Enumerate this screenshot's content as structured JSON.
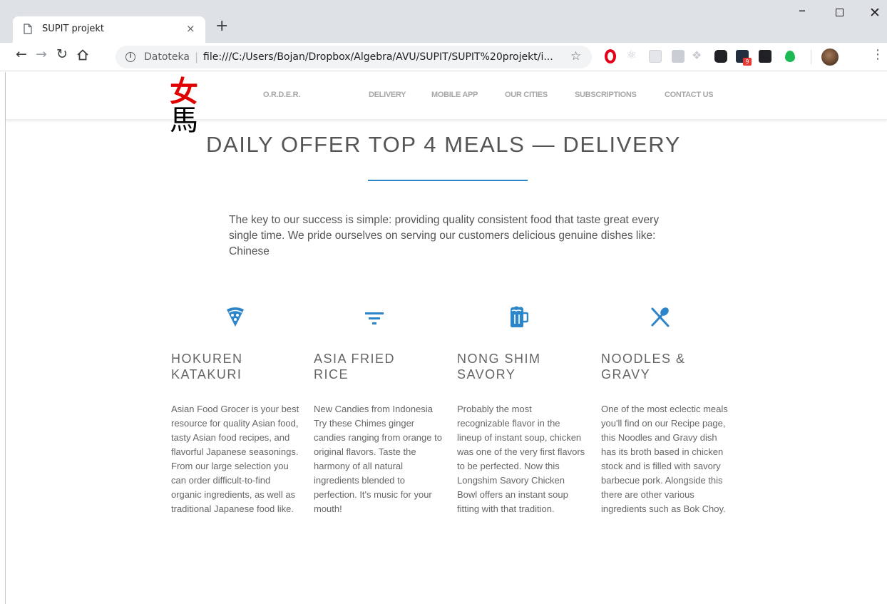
{
  "browser": {
    "tab_title": "SUPIT projekt",
    "tab_close": "×",
    "new_tab": "+",
    "url_scheme": "Datoteka",
    "url_separator": "|",
    "url": "file:///C:/Users/Bojan/Dropbox/Algebra/AVU/SUPIT/SUPIT%20projekt/i...",
    "ext_badge": "9",
    "window_min": "–",
    "window_close": "✕"
  },
  "header": {
    "logo_char_1": "女",
    "logo_char_2": "馬",
    "nav": [
      {
        "label": "O.R.D.E.R."
      },
      {
        "label": "DELIVERY"
      },
      {
        "label": "MOBILE APP"
      },
      {
        "label": "OUR CITIES"
      },
      {
        "label": "SUBSCRIPTIONS"
      },
      {
        "label": "CONTACT US"
      }
    ]
  },
  "main": {
    "title": "DAILY OFFER TOP 4 MEALS — DELIVERY",
    "intro": "The key to our success is simple: providing quality consistent food that taste great every single time. We pride ourselves on serving our customers delicious genuine dishes like: Chinese",
    "accent_color": "#2d85c9",
    "cards": [
      {
        "icon": "pizza-icon",
        "title_line1": "HOKUREN",
        "title_line2": "KATAKURI",
        "text": "Asian Food Grocer is your best resource for quality Asian food, tasty Asian food recipes, and flavorful Japanese seasonings. From our large selection you can order difficult-to-find organic ingredients, as well as traditional Japanese food like."
      },
      {
        "icon": "filter-icon",
        "title_line1": "ASIA  FRIED",
        "title_line2": "RICE",
        "text": "New Candies from Indonesia Try these Chimes ginger candies ranging from orange to original flavors. Taste the harmony of all natural ingredients blended to perfection. It's music for your mouth!"
      },
      {
        "icon": "beer-mug-icon",
        "title_line1": "NONG  SHIM",
        "title_line2": "SAVORY",
        "text": "Probably the most recognizable flavor in the lineup of instant soup, chicken was one of the very first flavors to be perfected. Now this Longshim Savory Chicken Bowl offers an instant soup fitting with that tradition."
      },
      {
        "icon": "utensils-icon",
        "title_line1": "NOODLES  &",
        "title_line2": "GRAVY",
        "text": "One of the most eclectic meals you'll find on our Recipe page, this Noodles and Gravy dish has its broth based in chicken stock and is filled with savory barbecue pork. Alongside this there are other various ingredients such as Bok Choy."
      }
    ]
  }
}
